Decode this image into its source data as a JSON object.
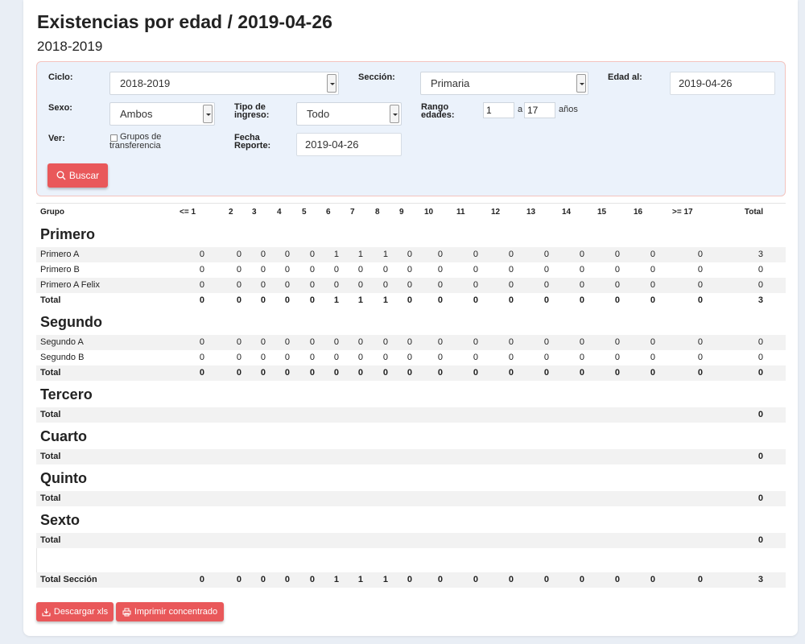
{
  "page": {
    "title": "Existencias por edad / 2019-04-26",
    "subtitle": "2018-2019"
  },
  "filters": {
    "ciclo_label": "Ciclo:",
    "ciclo_value": "2018-2019",
    "seccion_label": "Sección:",
    "seccion_value": "Primaria",
    "edad_al_label": "Edad al:",
    "edad_al_value": "2019-04-26",
    "sexo_label": "Sexo:",
    "sexo_value": "Ambos",
    "tipo_ingreso_label_1": "Tipo de",
    "tipo_ingreso_label_2": "ingreso:",
    "tipo_ingreso_value": "Todo",
    "rango_label_1": "Rango",
    "rango_label_2": "edades:",
    "rango_from": "1",
    "rango_sep": "a",
    "rango_to": "17",
    "rango_unit": "años",
    "ver_label": "Ver:",
    "grupos_label_1": "Grupos de",
    "grupos_label_2": "transferencia",
    "fecha_label_1": "Fecha",
    "fecha_label_2": "Reporte:",
    "fecha_value": "2019-04-26",
    "buscar_label": "Buscar"
  },
  "table": {
    "columns": [
      "Grupo",
      "<= 1",
      "2",
      "3",
      "4",
      "5",
      "6",
      "7",
      "8",
      "9",
      "10",
      "11",
      "12",
      "13",
      "14",
      "15",
      "16",
      ">= 17",
      "Total"
    ],
    "sections": [
      {
        "title": "Primero",
        "rows": [
          {
            "name": "Primero A",
            "values": [
              "0",
              "0",
              "0",
              "0",
              "0",
              "1",
              "1",
              "1",
              "0",
              "0",
              "0",
              "0",
              "0",
              "0",
              "0",
              "0",
              "0",
              "3"
            ]
          },
          {
            "name": "Primero B",
            "values": [
              "0",
              "0",
              "0",
              "0",
              "0",
              "0",
              "0",
              "0",
              "0",
              "0",
              "0",
              "0",
              "0",
              "0",
              "0",
              "0",
              "0",
              "0"
            ]
          },
          {
            "name": "Primero A Felix",
            "values": [
              "0",
              "0",
              "0",
              "0",
              "0",
              "0",
              "0",
              "0",
              "0",
              "0",
              "0",
              "0",
              "0",
              "0",
              "0",
              "0",
              "0",
              "0"
            ]
          }
        ],
        "total": {
          "name": "Total",
          "values": [
            "0",
            "0",
            "0",
            "0",
            "0",
            "1",
            "1",
            "1",
            "0",
            "0",
            "0",
            "0",
            "0",
            "0",
            "0",
            "0",
            "0",
            "3"
          ]
        }
      },
      {
        "title": "Segundo",
        "rows": [
          {
            "name": "Segundo A",
            "values": [
              "0",
              "0",
              "0",
              "0",
              "0",
              "0",
              "0",
              "0",
              "0",
              "0",
              "0",
              "0",
              "0",
              "0",
              "0",
              "0",
              "0",
              "0"
            ]
          },
          {
            "name": "Segundo B",
            "values": [
              "0",
              "0",
              "0",
              "0",
              "0",
              "0",
              "0",
              "0",
              "0",
              "0",
              "0",
              "0",
              "0",
              "0",
              "0",
              "0",
              "0",
              "0"
            ]
          }
        ],
        "total": {
          "name": "Total",
          "values": [
            "0",
            "0",
            "0",
            "0",
            "0",
            "0",
            "0",
            "0",
            "0",
            "0",
            "0",
            "0",
            "0",
            "0",
            "0",
            "0",
            "0",
            "0"
          ]
        }
      },
      {
        "title": "Tercero",
        "rows": [],
        "total": {
          "name": "Total",
          "values": [
            "",
            "",
            "",
            "",
            "",
            "",
            "",
            "",
            "",
            "",
            "",
            "",
            "",
            "",
            "",
            "",
            "",
            "0"
          ]
        }
      },
      {
        "title": "Cuarto",
        "rows": [],
        "total": {
          "name": "Total",
          "values": [
            "",
            "",
            "",
            "",
            "",
            "",
            "",
            "",
            "",
            "",
            "",
            "",
            "",
            "",
            "",
            "",
            "",
            "0"
          ]
        }
      },
      {
        "title": "Quinto",
        "rows": [],
        "total": {
          "name": "Total",
          "values": [
            "",
            "",
            "",
            "",
            "",
            "",
            "",
            "",
            "",
            "",
            "",
            "",
            "",
            "",
            "",
            "",
            "",
            "0"
          ]
        }
      },
      {
        "title": "Sexto",
        "rows": [],
        "total": {
          "name": "Total",
          "values": [
            "",
            "",
            "",
            "",
            "",
            "",
            "",
            "",
            "",
            "",
            "",
            "",
            "",
            "",
            "",
            "",
            "",
            "0"
          ]
        }
      }
    ],
    "grand_total": {
      "name": "Total Sección",
      "values": [
        "0",
        "0",
        "0",
        "0",
        "0",
        "1",
        "1",
        "1",
        "0",
        "0",
        "0",
        "0",
        "0",
        "0",
        "0",
        "0",
        "0",
        "3"
      ]
    }
  },
  "actions": {
    "download_label": "Descargar xls",
    "print_label": "Imprimir concentrado"
  },
  "colors": {
    "accent": "#e9585a",
    "panel_bg": "#ebf2fb",
    "panel_border": "#f3c4bf",
    "row_grey": "#f2f2f2"
  }
}
